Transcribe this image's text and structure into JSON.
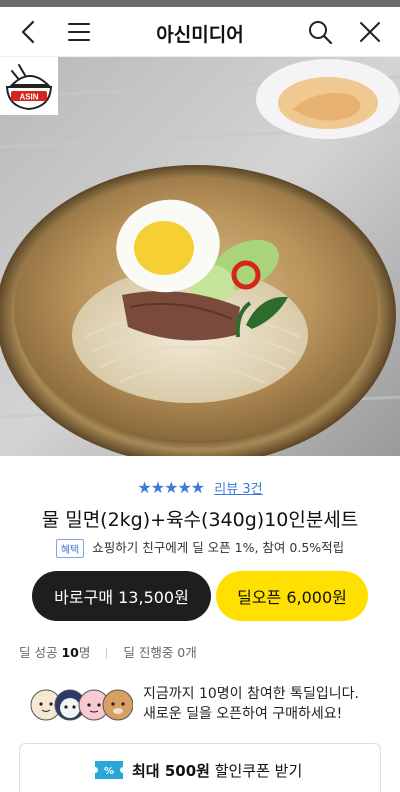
{
  "header": {
    "title": "아신미디어"
  },
  "hero": {
    "logo_text": "ASIN"
  },
  "product": {
    "stars": "★★★★★",
    "review_link": "리뷰 3건",
    "title": "물 밀면(2kg)+육수(340g)10인분세트",
    "benefit_tag": "혜택",
    "benefit_text": "쇼핑하기 친구에게 딜 오픈 1%, 참여 0.5%적립"
  },
  "buttons": {
    "buy_label": "바로구매 13,500원",
    "deal_label": "딜오픈 6,000원"
  },
  "stats": {
    "success_label": "딜 성공",
    "success_count": "10",
    "success_unit": "명",
    "progress_label": "딜 진행중 0개"
  },
  "notice": {
    "line1": "지금까지 10명이 참여한 톡딜입니다.",
    "line2": "새로운 딜을 오픈하여 구매하세요!"
  },
  "coupon": {
    "max_label": "최대 500원",
    "rest_label": " 할인쿠폰 받기",
    "ticket_symbol": "%"
  },
  "colors": {
    "accent_blue": "#3d7bd9",
    "deal_yellow": "#ffe000",
    "buy_black": "#1e1e1e"
  }
}
